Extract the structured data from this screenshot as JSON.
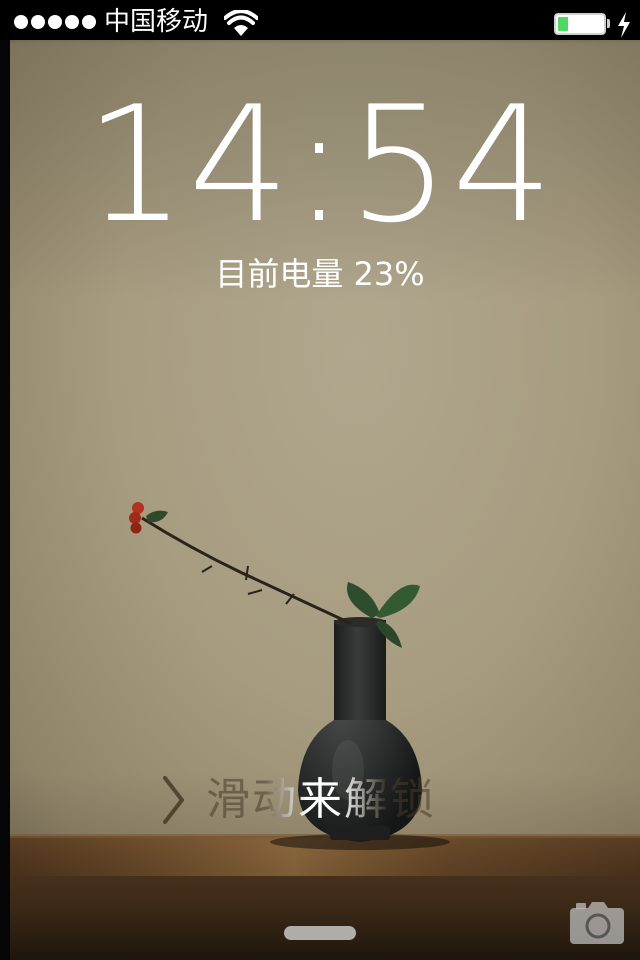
{
  "status_bar": {
    "signal_bars": 5,
    "carrier": "中国移动",
    "wifi_icon": "wifi-icon",
    "battery_level": 0.23,
    "charging_icon": "charging-bolt-icon",
    "battery_fill_color": "#4cd964"
  },
  "lockscreen": {
    "time": "14:54",
    "battery_status": "目前电量 23%",
    "slide_to_unlock": "滑动来解锁",
    "chevron_icon": "chevron-right-icon",
    "camera_icon": "camera-icon",
    "grabber": "control-center-grabber"
  }
}
